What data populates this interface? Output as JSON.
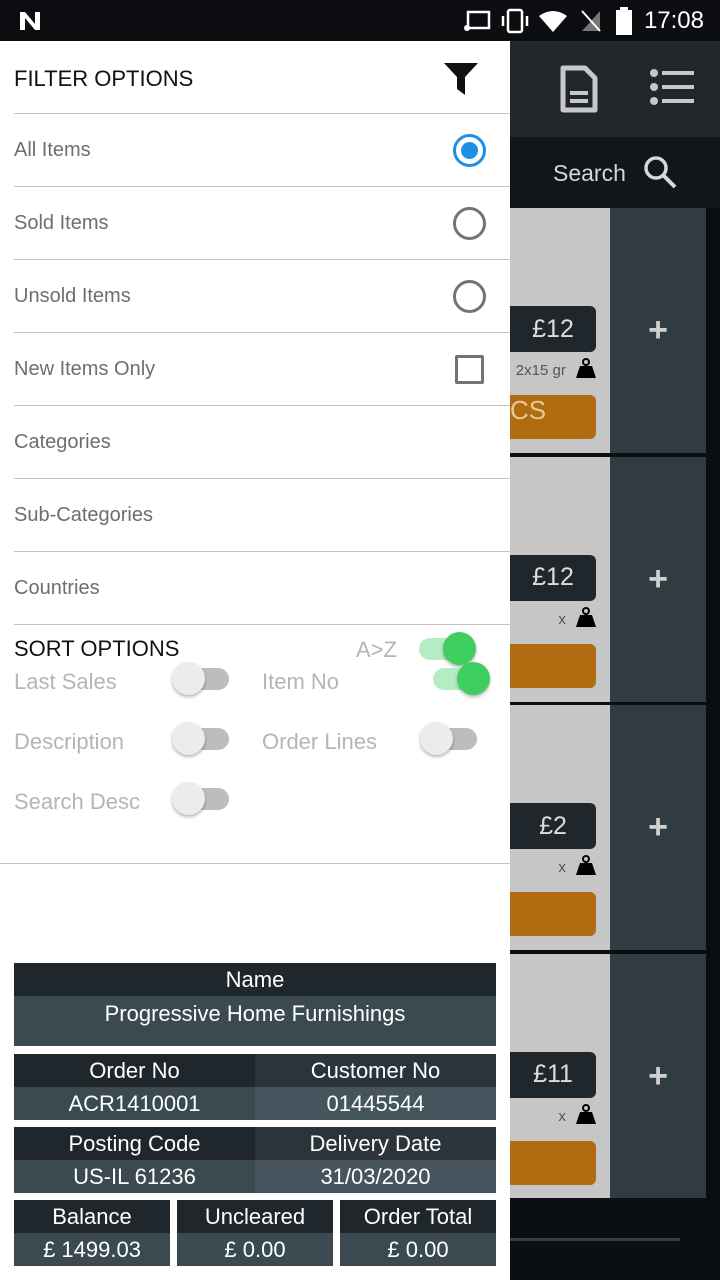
{
  "status_bar": {
    "time": "17:08"
  },
  "background": {
    "search_label": "Search",
    "items": [
      {
        "price": "£12",
        "weight": "2x15 gr",
        "button": "CS"
      },
      {
        "price": "£12",
        "weight": "x",
        "button": ""
      },
      {
        "price": "£2",
        "weight": "x",
        "button": ""
      },
      {
        "price": "£11",
        "weight": "x",
        "button": ""
      }
    ],
    "add_label": "+",
    "colors": {
      "button": "#b06c10",
      "tag": "#1f272c"
    }
  },
  "drawer": {
    "filter_title": "FILTER OPTIONS",
    "filters": [
      {
        "label": "All Items",
        "type": "radio",
        "checked": true
      },
      {
        "label": "Sold Items",
        "type": "radio",
        "checked": false
      },
      {
        "label": "Unsold Items",
        "type": "radio",
        "checked": false
      },
      {
        "label": "New Items Only",
        "type": "checkbox",
        "checked": false
      },
      {
        "label": "Categories",
        "type": "link"
      },
      {
        "label": "Sub-Categories",
        "type": "link"
      },
      {
        "label": "Countries",
        "type": "link"
      }
    ],
    "sort_title": "SORT OPTIONS",
    "sort_order": {
      "label": "A>Z",
      "on": true
    },
    "sorts": [
      {
        "label": "Last Sales",
        "on": false
      },
      {
        "label": "Item No",
        "on": true
      },
      {
        "label": "Description",
        "on": false
      },
      {
        "label": "Order Lines",
        "on": false
      },
      {
        "label": "Search Desc",
        "on": false
      }
    ],
    "accent": "#1e8fe6",
    "toggle_on": "#3fcf60"
  },
  "summary": {
    "name": {
      "label": "Name",
      "value": "Progressive Home Furnishings"
    },
    "order_no": {
      "label": "Order No",
      "value": "ACR1410001"
    },
    "customer_no": {
      "label": "Customer No",
      "value": "01445544"
    },
    "posting_code": {
      "label": "Posting Code",
      "value": "US-IL 61236"
    },
    "delivery_date": {
      "label": "Delivery Date",
      "value": "31/03/2020"
    },
    "balance": {
      "label": "Balance",
      "value": "£ 1499.03"
    },
    "uncleared": {
      "label": "Uncleared",
      "value": "£ 0.00"
    },
    "order_total": {
      "label": "Order Total",
      "value": "£ 0.00"
    }
  }
}
